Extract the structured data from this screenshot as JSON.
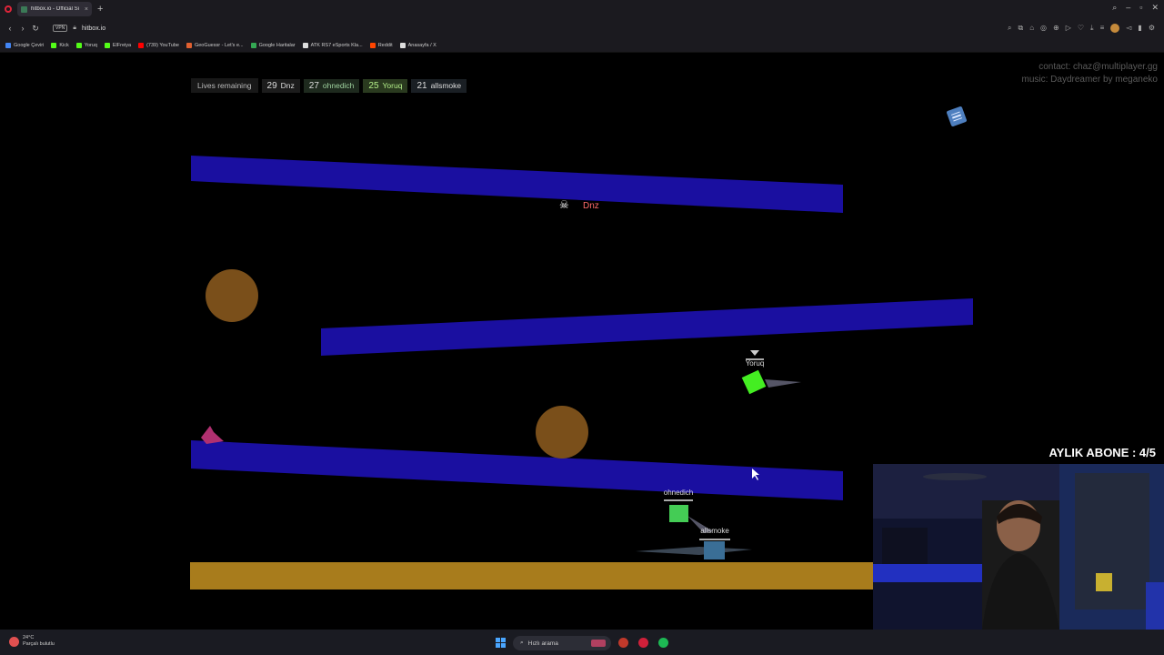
{
  "browser": {
    "tab_title": "hitbox.io - Official Si",
    "new_tab": "+",
    "url": "hitbox.io",
    "vpn": "VPN",
    "bookmarks": [
      {
        "label": "Google Çeviri",
        "color": "#4285f4"
      },
      {
        "label": "Kick",
        "color": "#53fc18"
      },
      {
        "label": "Yoruq",
        "color": "#53fc18"
      },
      {
        "label": "ElFreiya",
        "color": "#53fc18"
      },
      {
        "label": "(739) YouTube",
        "color": "#ff0000"
      },
      {
        "label": "GeoGuessr - Let's e...",
        "color": "#e06030"
      },
      {
        "label": "Google Haritalar",
        "color": "#34a853"
      },
      {
        "label": "ATK RS7 eSports Kla...",
        "color": "#dddddd"
      },
      {
        "label": "Reddit",
        "color": "#ff4500"
      },
      {
        "label": "Anasayfa / X",
        "color": "#dddddd"
      }
    ]
  },
  "page": {
    "credits_contact": "contact: chaz@multiplayer.gg",
    "credits_music": "music: Daydreamer by meganeko"
  },
  "scoreboard": {
    "label": "Lives remaining",
    "players": [
      {
        "lives": "29",
        "name": "Dnz",
        "cls": "c-dnz"
      },
      {
        "lives": "27",
        "name": "ohnedich",
        "cls": "c-ohnedich"
      },
      {
        "lives": "25",
        "name": "Yoruq",
        "cls": "c-yoruq"
      },
      {
        "lives": "21",
        "name": "allsmoke",
        "cls": "c-allsmoke"
      }
    ]
  },
  "game": {
    "dead_player": "Dnz",
    "players": {
      "yoruq": "Yoruq",
      "ohnedich": "ohnedich",
      "allsmoke": "allsmoke"
    },
    "colors": {
      "platform": "#1a0fa0",
      "ball": "#7a4f1a",
      "floor": "#a87c1c",
      "yoruq": "#44ee22",
      "ohnedich": "#44cc55",
      "allsmoke": "#3a6e96",
      "spike": "#b03070"
    }
  },
  "stream": {
    "sub_counter": "AYLIK ABONE : 4/5"
  },
  "taskbar": {
    "temp": "24°C",
    "weather": "Parçalı bulutlu",
    "search_placeholder": "Hızlı arama"
  }
}
